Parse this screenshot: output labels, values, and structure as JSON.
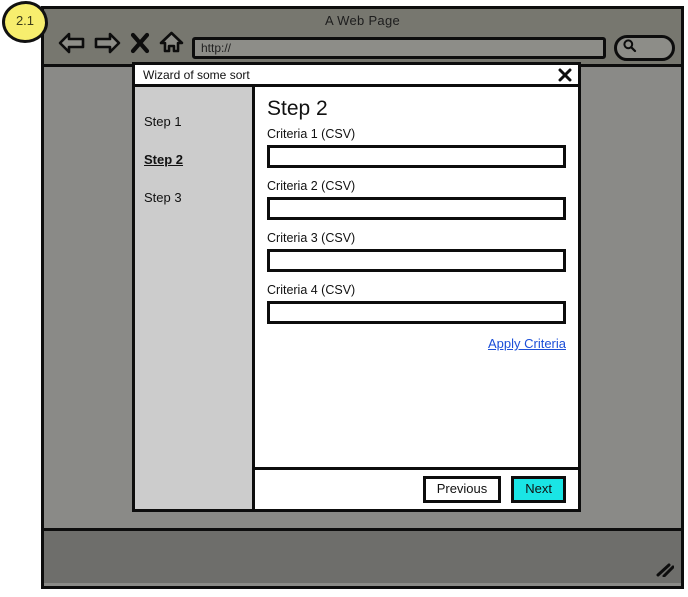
{
  "annotation": {
    "label": "2.1",
    "color": "#f7ee6e"
  },
  "browser": {
    "title": "A Web Page",
    "nav": {
      "back_icon": "back-arrow-icon",
      "forward_icon": "forward-arrow-icon",
      "stop_icon": "stop-x-icon",
      "home_icon": "home-icon"
    },
    "address_bar": {
      "value": "http://",
      "placeholder": "http://"
    },
    "search": {
      "icon": "search-icon",
      "value": "",
      "placeholder": ""
    },
    "status_bar": {
      "resize_grip_icon": "resize-grip-icon"
    }
  },
  "dialog": {
    "title": "Wizard of some sort",
    "close_icon": "close-icon",
    "sidebar": {
      "steps": [
        {
          "label": "Step 1",
          "active": false
        },
        {
          "label": "Step 2",
          "active": true
        },
        {
          "label": "Step 3",
          "active": false
        }
      ]
    },
    "content": {
      "heading": "Step 2",
      "fields": [
        {
          "label": "Criteria 1 (CSV)",
          "value": "",
          "placeholder": ""
        },
        {
          "label": "Criteria 2 (CSV)",
          "value": "",
          "placeholder": ""
        },
        {
          "label": "Criteria 3 (CSV)",
          "value": "",
          "placeholder": ""
        },
        {
          "label": "Criteria 4 (CSV)",
          "value": "",
          "placeholder": ""
        }
      ],
      "apply_link": "Apply Criteria",
      "apply_link_color": "#1c4fd8"
    },
    "footer": {
      "previous_label": "Previous",
      "next_label": "Next",
      "next_color": "#1ae5e5"
    }
  }
}
